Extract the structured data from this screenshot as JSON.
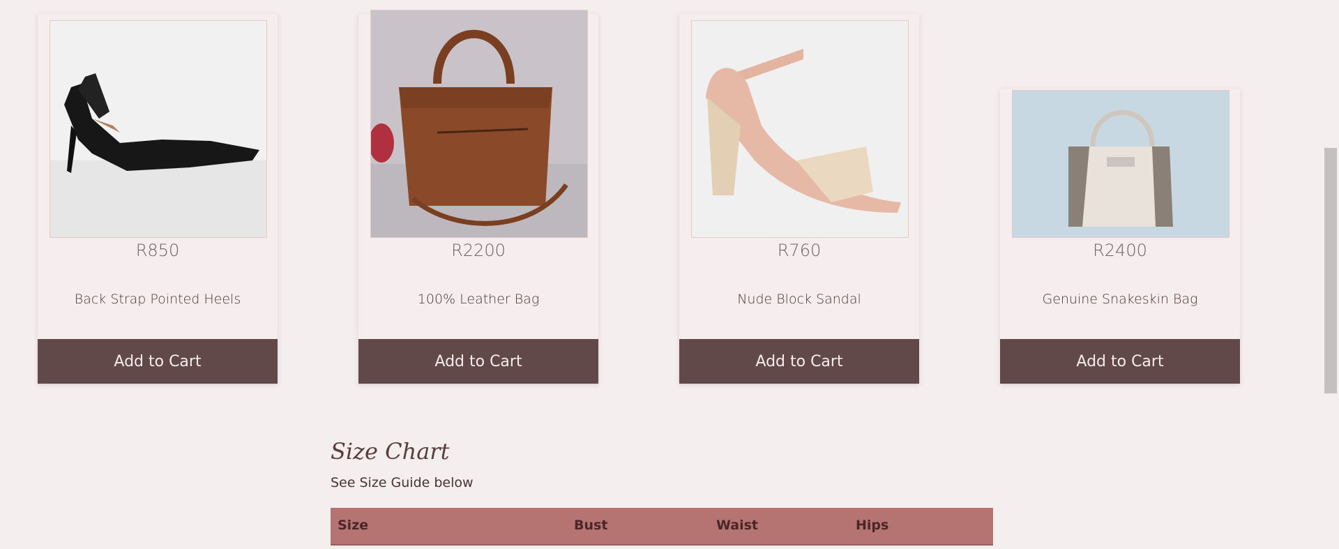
{
  "products": [
    {
      "price": "R850",
      "name": "Back Strap Pointed Heels",
      "button": "Add to Cart",
      "image": "black-slingback-heel-image"
    },
    {
      "price": "R2200",
      "name": "100% Leather Bag",
      "button": "Add to Cart",
      "image": "brown-leather-bag-image"
    },
    {
      "price": "R760",
      "name": "Nude Block Sandal",
      "button": "Add to Cart",
      "image": "nude-block-sandal-image"
    },
    {
      "price": "R2400",
      "name": "Genuine Snakeskin Bag",
      "button": "Add to Cart",
      "image": "snakeskin-bag-image"
    }
  ],
  "size_chart": {
    "title": "Size Chart",
    "subtitle": "See Size Guide below",
    "headers": [
      "Size",
      "Bust",
      "Waist",
      "Hips"
    ]
  },
  "colors": {
    "background": "#f5eeee",
    "button": "#614849",
    "table_header": "#b57472"
  }
}
